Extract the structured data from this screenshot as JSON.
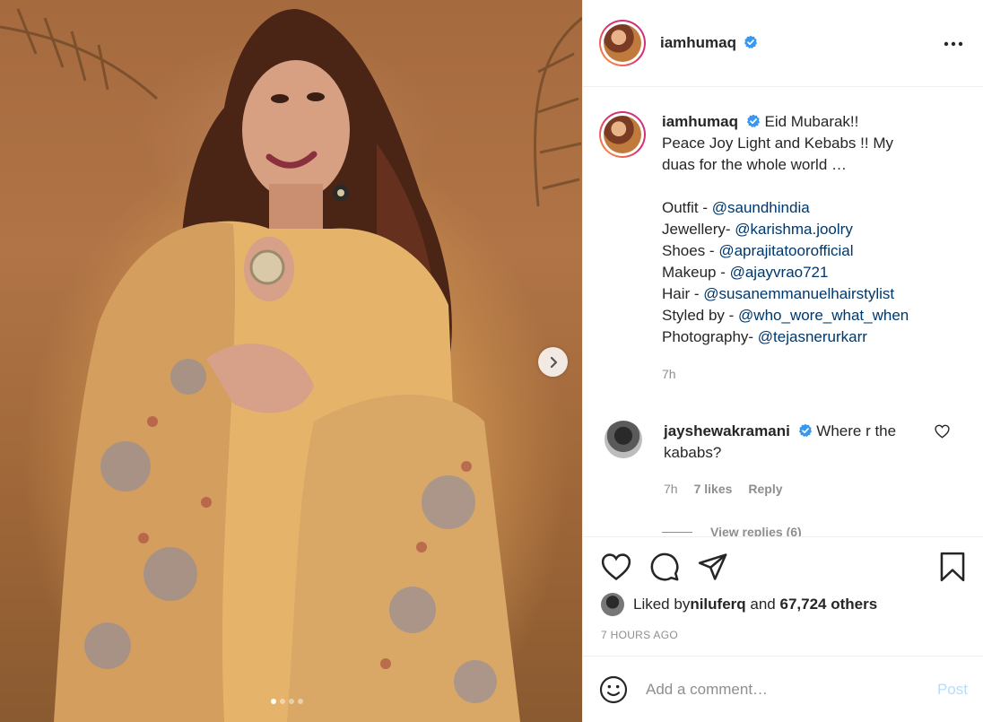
{
  "post": {
    "username": "iamhumaq",
    "more_icon": "more-horizontal-icon",
    "caption": {
      "username": "iamhumaq",
      "lines": [
        "Eid Mubarak!!",
        "Peace Joy Light and Kebabs !! My",
        "duas for the whole world …"
      ],
      "credits": [
        {
          "label": "Outfit - ",
          "mention": "@saundhindia"
        },
        {
          "label": "Jewellery- ",
          "mention": "@karishma.joolry"
        },
        {
          "label": "Shoes - ",
          "mention": "@aprajitatoorofficial"
        },
        {
          "label": "Makeup - ",
          "mention": "@ajayvrao721"
        },
        {
          "label": "Hair - ",
          "mention": "@susanemmanuelhairstylist"
        },
        {
          "label": "Styled by - ",
          "mention": "@who_wore_what_when"
        },
        {
          "label": "Photography- ",
          "mention": "@tejasnerurkarr"
        }
      ],
      "time": "7h"
    },
    "comment": {
      "username": "jayshewakramani",
      "text": "Where r the kababs?",
      "time": "7h",
      "likes": "7 likes",
      "reply": "Reply",
      "view_replies": "View replies (6)"
    },
    "likes": {
      "prefix": "Liked by ",
      "user": "niluferq",
      "mid": " and ",
      "others": "67,724 others"
    },
    "posted_ago": "7 HOURS AGO",
    "add_comment": {
      "placeholder": "Add a comment…",
      "post_label": "Post"
    },
    "carousel": {
      "count": 4,
      "active": 1
    }
  },
  "colors": {
    "verified": "#3897f0",
    "mention": "#00376b",
    "post_disabled": "#b2dffc",
    "text_secondary": "#8e8e8e"
  },
  "icons": [
    "verified-badge-icon",
    "heart-icon",
    "comment-icon",
    "share-icon",
    "bookmark-icon",
    "emoji-icon",
    "chevron-right-icon"
  ]
}
